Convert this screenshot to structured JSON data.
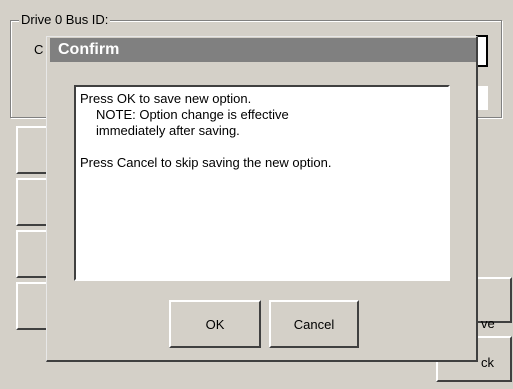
{
  "background": {
    "group_title": "Drive 0 Bus ID:",
    "combo_visible_letter": "C",
    "right_buttons": [
      {
        "label_fragment": "ve"
      },
      {
        "label_fragment": "ck"
      }
    ]
  },
  "dialog": {
    "title": "Confirm",
    "message": {
      "line1": "Press OK to save new option.",
      "line2": "NOTE: Option change is effective",
      "line3": "immediately after saving.",
      "line4": "Press Cancel to skip saving the new option."
    },
    "ok_label": "OK",
    "cancel_label": "Cancel"
  },
  "colors": {
    "face": "#d4d0c8",
    "titlebar_inactive": "#808080",
    "title_text": "#ffffff",
    "message_bg": "#ffffff"
  }
}
